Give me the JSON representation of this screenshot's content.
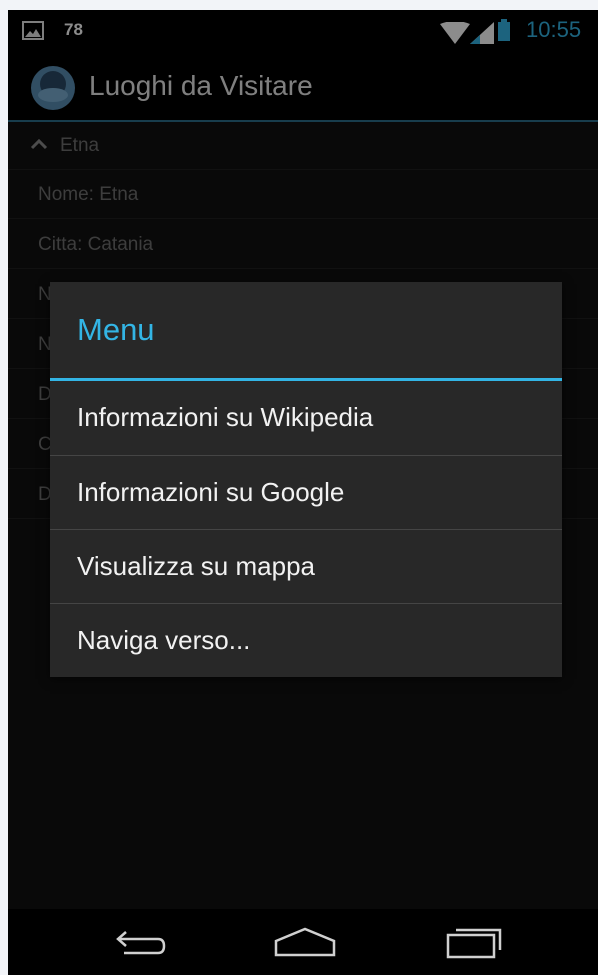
{
  "status_bar": {
    "notification_icon": "image-icon",
    "notification_count": "78",
    "time": "10:55",
    "icons": [
      "wifi-icon",
      "signal-icon",
      "battery-icon"
    ]
  },
  "action_bar": {
    "app_icon": "app-logo-icon",
    "title": "Luoghi da Visitare"
  },
  "list": {
    "header": {
      "icon": "chevron-up-icon",
      "label": "Etna"
    },
    "rows": [
      "Nome: Etna",
      "Citta: Catania",
      "N",
      "N",
      "D",
      "C",
      "D"
    ]
  },
  "dialog": {
    "title": "Menu",
    "items": [
      "Informazioni su Wikipedia",
      "Informazioni su Google",
      "Visualizza su mappa",
      "Naviga verso..."
    ]
  },
  "nav_bar": {
    "icons": [
      "back-icon",
      "home-icon",
      "recent-apps-icon"
    ]
  },
  "colors": {
    "accent": "#33b5e5",
    "background": "#000000",
    "dialog": "#282828"
  }
}
